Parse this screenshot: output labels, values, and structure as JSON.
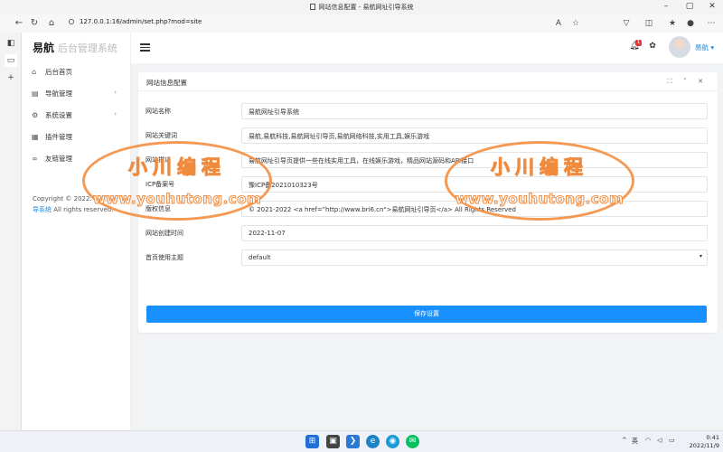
{
  "browser": {
    "tab_title": "网站信息配置 - 易航网址引导系统",
    "url": "127.0.0.1:16/admin/set.php?mod=site"
  },
  "sidebar": {
    "brand_main": "易航",
    "brand_sub": "后台管理系统",
    "items": [
      {
        "label": "后台首页",
        "icon": "home-icon",
        "has_arrow": false
      },
      {
        "label": "导航管理",
        "icon": "list-icon",
        "has_arrow": true
      },
      {
        "label": "系统设置",
        "icon": "gear-icon",
        "has_arrow": true
      },
      {
        "label": "插件管理",
        "icon": "plugin-icon",
        "has_arrow": false
      },
      {
        "label": "友链管理",
        "icon": "link-icon",
        "has_arrow": false
      }
    ],
    "arrow": "›",
    "copyright_line1": "Copyright © 2022.",
    "copyright_faded": "易航网址引",
    "copyright_link": "导系统",
    "copyright_rights": "All rights reserved."
  },
  "topbar": {
    "notification_count": "1",
    "username": "易航",
    "username_caret": "▾"
  },
  "card": {
    "title": "网站信息配置",
    "fields": [
      {
        "label": "网站名称",
        "value": "易航网址引导系统"
      },
      {
        "label": "网站关键词",
        "value": "易航,易航科技,易航网址引导页,易航网络科技,实用工具,娱乐游戏"
      },
      {
        "label": "网站描述",
        "value": "易航网址引导页提供一些在线实用工具，在线娱乐游戏，精品网站源码和API接口"
      },
      {
        "label": "ICP备案号",
        "value": "豫ICP备2021010323号"
      },
      {
        "label": "版权信息",
        "value": "© 2021-2022 <a href=\"http://www.bri6.cn\">易航网址引导页</a> All Rights Reserved"
      },
      {
        "label": "网站创建时间",
        "value": "2022-11-07"
      },
      {
        "label": "首页使用主题",
        "value": "default"
      }
    ],
    "select_caret": "▾",
    "save_label": "保存设置"
  },
  "watermark": {
    "line1": "小川编程",
    "line2": "www.youhutong.com",
    "color": "#f08a3c"
  },
  "taskbar": {
    "ime": "英",
    "time": "0:41",
    "date": "2022/11/9",
    "tray_caret": "^"
  },
  "colors": {
    "accent": "#1890ff",
    "link": "#1e88e5",
    "badge": "#e53935"
  }
}
